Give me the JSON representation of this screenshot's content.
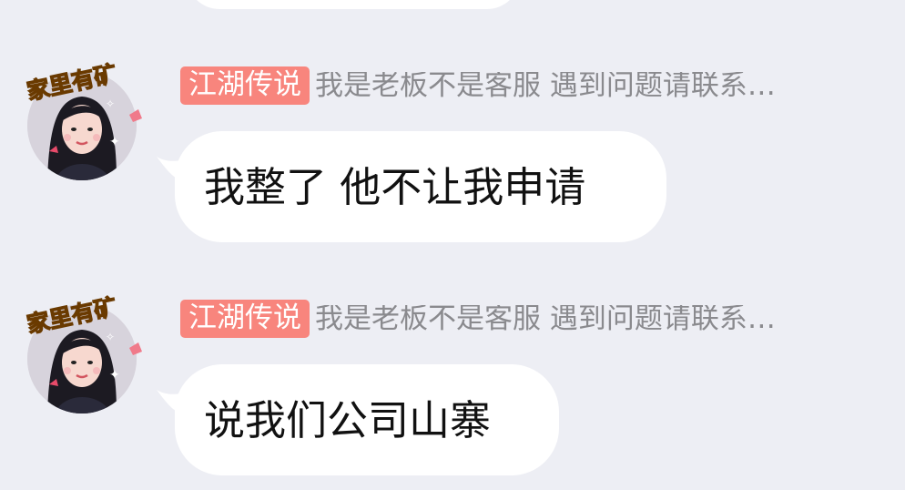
{
  "chat": {
    "previous_message": {
      "text": ""
    },
    "messages": [
      {
        "sender_tag": "江湖传说",
        "sender_name": "我是老板不是客服 遇到问题请联系…",
        "avatar_caption": "家里有矿",
        "text": "我整了 他不让我申请"
      },
      {
        "sender_tag": "江湖传说",
        "sender_name": "我是老板不是客服 遇到问题请联系…",
        "avatar_caption": "家里有矿",
        "text": "说我们公司山寨"
      }
    ]
  },
  "colors": {
    "background": "#edeef4",
    "bubble": "#ffffff",
    "tag_background": "#f8857d",
    "tag_text": "#ffffff",
    "nickname_text": "#8a8a8e",
    "message_text": "#111111",
    "avatar_caption": "#f5b400"
  }
}
